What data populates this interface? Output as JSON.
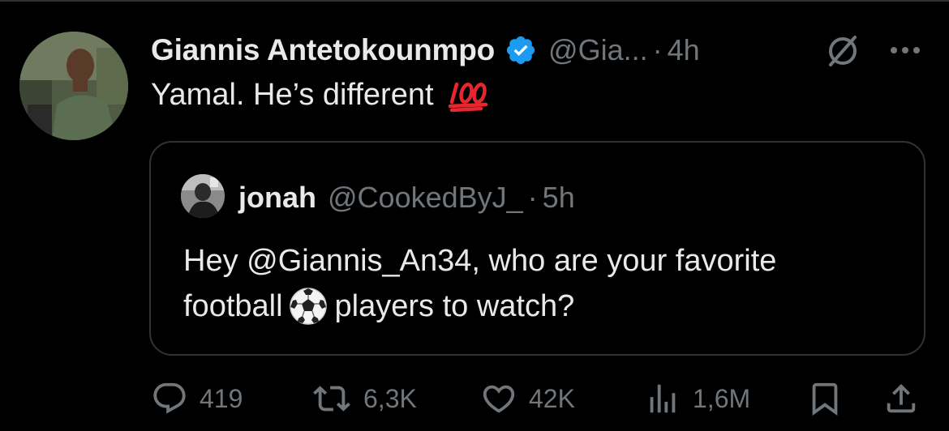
{
  "tweet": {
    "author_name": "Giannis Antetokounmpo",
    "author_handle": "@Gia...",
    "separator": "·",
    "time": "4h",
    "text": "Yamal. He’s different"
  },
  "quote": {
    "author_name": "jonah",
    "author_handle": "@CookedByJ_",
    "separator": "·",
    "time": "5h",
    "line1": "Hey @Giannis_An34, who are your favorite",
    "line2_before": "football",
    "line2_after": "players to watch?"
  },
  "actions": {
    "replies": "419",
    "reposts": "6,3K",
    "likes": "42K",
    "views": "1,6M"
  },
  "icons": {
    "verified": "verified-badge-icon",
    "grok": "grok-icon",
    "more": "more-icon",
    "reply": "reply-icon",
    "repost": "repost-icon",
    "like": "like-icon",
    "views": "views-icon",
    "bookmark": "bookmark-icon",
    "share": "share-icon",
    "hundred": "hundred-points-emoji",
    "soccer": "soccer-ball-emoji"
  },
  "colors": {
    "background": "#000000",
    "text": "#e7e9ea",
    "muted": "#71767b",
    "border": "#2f3336",
    "verified": "#1d9bf0",
    "emoji_red": "#e8262f"
  }
}
